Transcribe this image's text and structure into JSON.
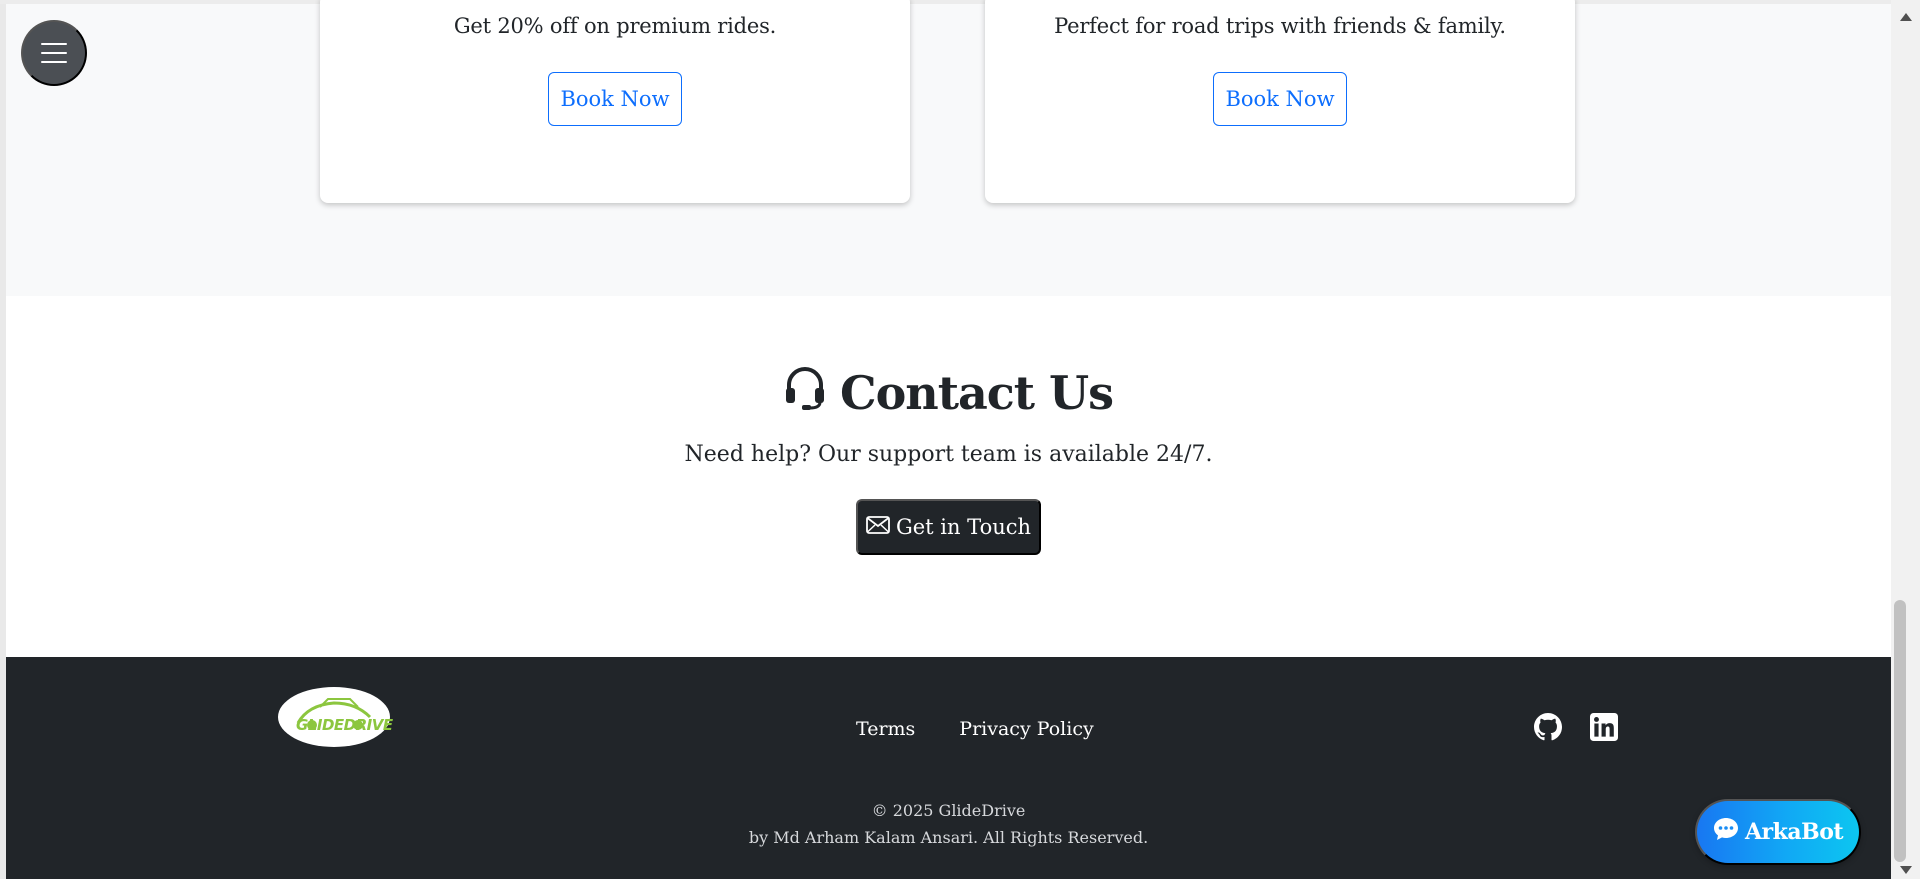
{
  "offers": {
    "cards": [
      {
        "text": "Get 20% off on premium rides.",
        "button": "Book Now"
      },
      {
        "text": "Perfect for road trips with friends & family.",
        "button": "Book Now"
      }
    ]
  },
  "contact": {
    "title": "Contact Us",
    "subtitle": "Need help? Our support team is available 24/7.",
    "button": "Get in Touch",
    "title_icon": "headset-icon",
    "button_icon": "envelope-icon"
  },
  "footer": {
    "logo_text": "GLIDEDRIVE",
    "links": [
      "Terms",
      "Privacy Policy"
    ],
    "social_icons": [
      "github-icon",
      "linkedin-icon"
    ],
    "copyright": "© 2025 GlideDrive",
    "credit": "by Md Arham Kalam Ansari. All Rights Reserved."
  },
  "chat": {
    "label": "ArkaBot",
    "icon": "chat-bubble-icon"
  },
  "menu": {
    "icon": "hamburger-menu-icon"
  },
  "colors": {
    "primary": "#0d6efd",
    "dark": "#212529",
    "offers_bg": "#f8f9fa",
    "logo_green": "#8cc63f",
    "chat_gradient_start": "#1877f2",
    "chat_gradient_end": "#0cc6f0"
  }
}
